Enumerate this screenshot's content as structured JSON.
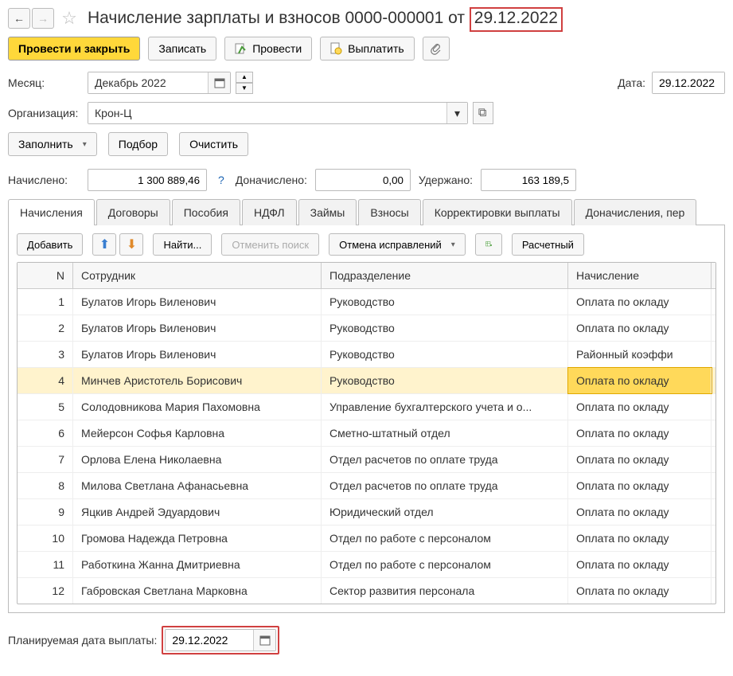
{
  "title": {
    "prefix": "Начисление зарплаты и взносов 0000-000001 от ",
    "date": "29.12.2022"
  },
  "toolbar": {
    "post_close": "Провести и закрыть",
    "write": "Записать",
    "post": "Провести",
    "pay": "Выплатить"
  },
  "fields": {
    "month_label": "Месяц:",
    "month_value": "Декабрь 2022",
    "date_label": "Дата:",
    "date_value": "29.12.2022",
    "org_label": "Организация:",
    "org_value": "Крон-Ц"
  },
  "actions": {
    "fill": "Заполнить",
    "pick": "Подбор",
    "clear": "Очистить"
  },
  "totals": {
    "accrued_label": "Начислено:",
    "accrued_value": "1 300 889,46",
    "additional_label": "Доначислено:",
    "additional_value": "0,00",
    "withheld_label": "Удержано:",
    "withheld_value": "163 189,5"
  },
  "tabs": {
    "0": "Начисления",
    "1": "Договоры",
    "2": "Пособия",
    "3": "НДФЛ",
    "4": "Займы",
    "5": "Взносы",
    "6": "Корректировки выплаты",
    "7": "Доначисления, пер"
  },
  "tab_toolbar": {
    "add": "Добавить",
    "find": "Найти...",
    "cancel_find": "Отменить поиск",
    "cancel_fix": "Отмена исправлений",
    "sheet": "Расчетный"
  },
  "grid": {
    "head": {
      "n": "N",
      "emp": "Сотрудник",
      "dep": "Подразделение",
      "acc": "Начисление"
    },
    "rows": [
      {
        "n": "1",
        "emp": "Булатов Игорь Виленович",
        "dep": "Руководство",
        "acc": "Оплата по окладу"
      },
      {
        "n": "2",
        "emp": "Булатов Игорь Виленович",
        "dep": "Руководство",
        "acc": "Оплата по окладу"
      },
      {
        "n": "3",
        "emp": "Булатов Игорь Виленович",
        "dep": "Руководство",
        "acc": "Районный коэффи"
      },
      {
        "n": "4",
        "emp": "Минчев Аристотель Борисович",
        "dep": "Руководство",
        "acc": "Оплата по окладу"
      },
      {
        "n": "5",
        "emp": "Солодовникова Мария Пахомовна",
        "dep": "Управление бухгалтерского учета и о...",
        "acc": "Оплата по окладу"
      },
      {
        "n": "6",
        "emp": "Мейерсон Софья Карловна",
        "dep": "Сметно-штатный отдел",
        "acc": "Оплата по окладу"
      },
      {
        "n": "7",
        "emp": "Орлова Елена Николаевна",
        "dep": "Отдел расчетов по оплате труда",
        "acc": "Оплата по окладу"
      },
      {
        "n": "8",
        "emp": "Милова Светлана Афанасьевна",
        "dep": "Отдел расчетов по оплате труда",
        "acc": "Оплата по окладу"
      },
      {
        "n": "9",
        "emp": "Яцкив Андрей Эдуардович",
        "dep": "Юридический отдел",
        "acc": "Оплата по окладу"
      },
      {
        "n": "10",
        "emp": "Громова Надежда Петровна",
        "dep": "Отдел по работе с персоналом",
        "acc": "Оплата по окладу"
      },
      {
        "n": "11",
        "emp": "Работкина Жанна Дмитриевна",
        "dep": "Отдел по работе с персоналом",
        "acc": "Оплата по окладу"
      },
      {
        "n": "12",
        "emp": "Габровская Светлана Марковна",
        "dep": "Сектор развития персонала",
        "acc": "Оплата по окладу"
      }
    ]
  },
  "footer": {
    "planned_label": "Планируемая дата выплаты:",
    "planned_value": "29.12.2022"
  }
}
